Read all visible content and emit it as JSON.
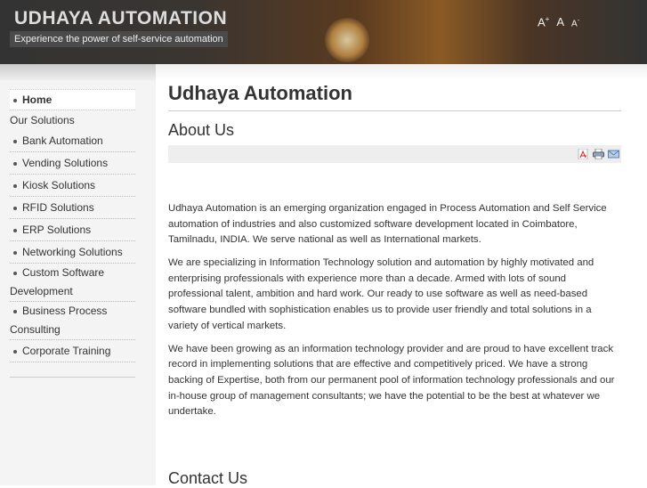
{
  "header": {
    "title": "UDHAYA AUTOMATION",
    "tagline": "Experience the power of self-service automation",
    "font_tools": {
      "increase": "A",
      "increase_sup": "+",
      "reset": "A",
      "decrease": "A",
      "decrease_sup": "-"
    }
  },
  "nav": {
    "home": "Home",
    "section": "Our Solutions",
    "items": [
      "Bank Automation",
      "Vending Solutions",
      "Kiosk Solutions",
      "RFID Solutions",
      "ERP Solutions",
      "Networking Solutions"
    ],
    "custom_1": "Custom Software",
    "custom_2": "Development",
    "bpc_1": "Business Process",
    "bpc_2": "Consulting",
    "training": "Corporate Training"
  },
  "main": {
    "title": "Udhaya Automation",
    "subtitle": "About Us",
    "icons": [
      "pdf-icon",
      "print-icon",
      "email-icon"
    ],
    "paragraphs": [
      "Udhaya Automation is an emerging organization engaged in Process Automation and Self Service automation of industries and also customized software development located in Coimbatore, Tamilnadu, INDIA. We serve national as well as International markets.",
      "We are specializing in Information Technology solution and automation by highly motivated and enterprising professionals with experience more than a decade. Armed with lots of sound professional talent, ambition and hard work. Our ready to use software as well as need-based software bundled with sophistication enables us to provide user friendly and total solutions in a variety of vertical markets.",
      "We have been growing as an information technology provider and are proud to have excellent track record in implementing solutions that are effective and competitively priced. We have a strong backing of Expertise, both from our permanent pool of information technology professionals and our in-house group of management consultants; we have the potential to be the best at whatever we undertake."
    ],
    "contact_heading": "Contact Us"
  }
}
